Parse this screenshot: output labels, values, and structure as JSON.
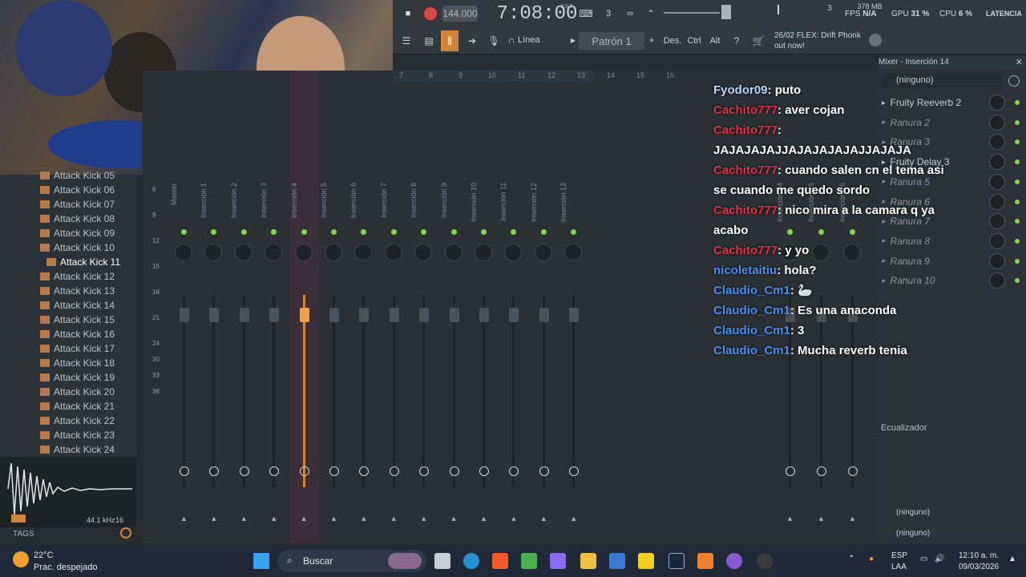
{
  "toolbar": {
    "tempo": "144.000",
    "clock": "7:08:00",
    "pattern_label": "Patrón 1",
    "mode_label": "Línea",
    "des_label": "Des.",
    "ctrl_label": "Ctrl",
    "alt_label": "Alt",
    "news_date": "26/02",
    "news_text": "FLEX: Drift Phonk out now!",
    "mem": "378 MB",
    "fps_label": "FPS",
    "fps_value": "N/A",
    "gpu_label": "GPU",
    "gpu_value": "31 %",
    "cpu_label": "CPU",
    "cpu_value": "6 %",
    "latency_label": "LATENCIA",
    "clock_small": "B:S:T",
    "num3": "3"
  },
  "browser": {
    "items": [
      "Attack Kick 05",
      "Attack Kick 06",
      "Attack Kick 07",
      "Attack Kick 08",
      "Attack Kick 09",
      "Attack Kick 10",
      "Attack Kick 11",
      "Attack Kick 12",
      "Attack Kick 13",
      "Attack Kick 14",
      "Attack Kick 15",
      "Attack Kick 16",
      "Attack Kick 17",
      "Attack Kick 18",
      "Attack Kick 19",
      "Attack Kick 20",
      "Attack Kick 21",
      "Attack Kick 22",
      "Attack Kick 23",
      "Attack Kick 24"
    ],
    "sample_rate": "44.1 kHz",
    "bit_depth": "16",
    "tags_label": "TAGS"
  },
  "mixer": {
    "scale": [
      "6",
      "9",
      "12",
      "15",
      "18",
      "21",
      "24",
      "30",
      "33",
      "36"
    ],
    "col_numbers": [
      "7",
      "8",
      "9",
      "10",
      "11",
      "12",
      "13",
      "14",
      "15",
      "16"
    ],
    "strips": [
      "Master",
      "Inserción 1",
      "Inserción 2",
      "Inserción 3",
      "Inserción 4",
      "Inserción 5",
      "Inserción 6",
      "Inserción 7",
      "Inserción 8",
      "Inserción 9",
      "Inserción 10",
      "Inserción 11",
      "Inserción 12",
      "Inserción 13"
    ],
    "right_strips": [
      "Inserción 14",
      "Inserción 15",
      "Inserción 16"
    ],
    "right_col": "14"
  },
  "side_panel": {
    "title": "Mixer - Inserción 14",
    "input": "(ninguno)",
    "slots": [
      {
        "name": "Fruity Reeverb 2",
        "active": true
      },
      {
        "name": "Ranura 2",
        "active": false
      },
      {
        "name": "Ranura 3",
        "active": false
      },
      {
        "name": "Fruity Delay 3",
        "active": true
      },
      {
        "name": "Ranura 5",
        "active": false
      },
      {
        "name": "Ranura 6",
        "active": false
      },
      {
        "name": "Ranura 7",
        "active": false
      },
      {
        "name": "Ranura 8",
        "active": false
      },
      {
        "name": "Ranura 9",
        "active": false
      },
      {
        "name": "Ranura 10",
        "active": false
      }
    ],
    "eq_label": "Ecualizador",
    "out1": "(ninguno)",
    "out2": "(ninguno)"
  },
  "chat": [
    {
      "user": "Fyodor09",
      "color": "#b8d6ff",
      "text": "puto"
    },
    {
      "user": "Cachito777",
      "color": "#e0304a",
      "text": "aver cojan"
    },
    {
      "user": "Cachito777",
      "color": "#e0304a",
      "text": "JAJAJAJAJJAJAJAJAJAJJAJAJA"
    },
    {
      "user": "Cachito777",
      "color": "#e0304a",
      "text": "cuando salen cn el tema asi se cuando me quedo sordo"
    },
    {
      "user": "Cachito777",
      "color": "#e0304a",
      "text": "nico mira a la camara q ya acabo"
    },
    {
      "user": "Cachito777",
      "color": "#e0304a",
      "text": "y yo"
    },
    {
      "user": "nicoletaitiu",
      "color": "#4a8cf0",
      "text": "hola?"
    },
    {
      "user": "Claudio_Cm1",
      "color": "#4a8cf0",
      "text": "🦢"
    },
    {
      "user": "Claudio_Cm1",
      "color": "#4a8cf0",
      "text": "Es una anaconda"
    },
    {
      "user": "Claudio_Cm1",
      "color": "#4a8cf0",
      "text": "3"
    },
    {
      "user": "Claudio_Cm1",
      "color": "#4a8cf0",
      "text": "Mucha reverb tenia"
    }
  ],
  "taskbar": {
    "temp": "22°C",
    "weather": "Prac. despejado",
    "search_placeholder": "Buscar",
    "lang": "ESP",
    "lang2": "LAA",
    "time": "12:10 a. m.",
    "date": "09/03/2026"
  }
}
